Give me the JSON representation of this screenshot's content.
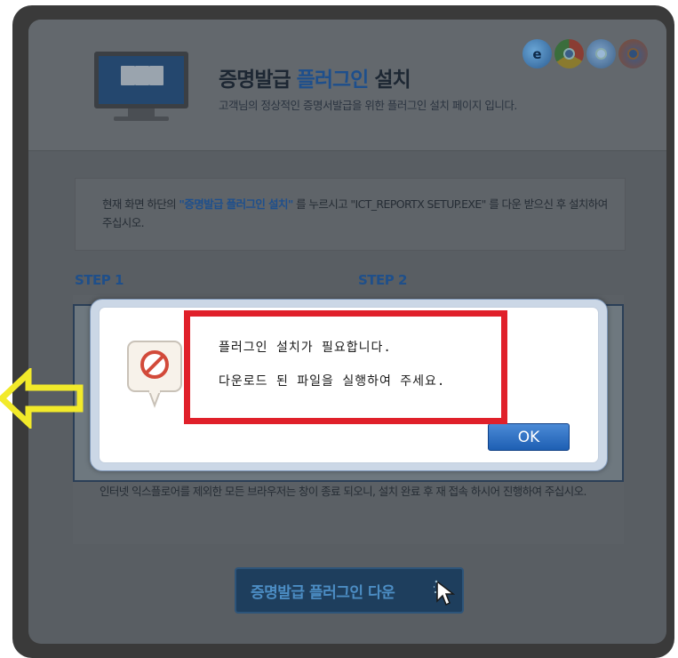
{
  "header": {
    "title_prefix": "증명발급",
    "title_highlight": "플러그인",
    "title_suffix": "설치",
    "subtitle": "고객님의 정상적인 증명서발급을 위한 플러그인 설치 페이지 입니다."
  },
  "browser_icons": [
    "ie-icon",
    "chrome-icon",
    "safari-icon",
    "firefox-icon"
  ],
  "info": {
    "text_before": "현재 화면 하단의 ",
    "highlight": "\"증명발급 플러그인 설치\"",
    "text_after": " 를 누르시고 \"ICT_REPORTX SETUP.EXE\" 를 다운 받으신 후 설치하여 주십시오."
  },
  "steps": {
    "step1": "STEP 1",
    "step2": "STEP 2"
  },
  "notice": "인터넷 익스플로어를 제외한 모든 브라우저는 창이 종료 되오니, 설치 완료 후 재 접속 하시어 진행하여 주십시오.",
  "download_button": {
    "label": "증명발급 플러그인 다운"
  },
  "dialog": {
    "line1": "플러그인 설치가 필요합니다.",
    "line2": "다운로드 된 파일을 실행하여 주세요.",
    "ok_label": "OK"
  },
  "colors": {
    "highlight_box": "#e0202a",
    "arrow": "#f2ea2a",
    "accent_blue": "#1e4f8c"
  }
}
